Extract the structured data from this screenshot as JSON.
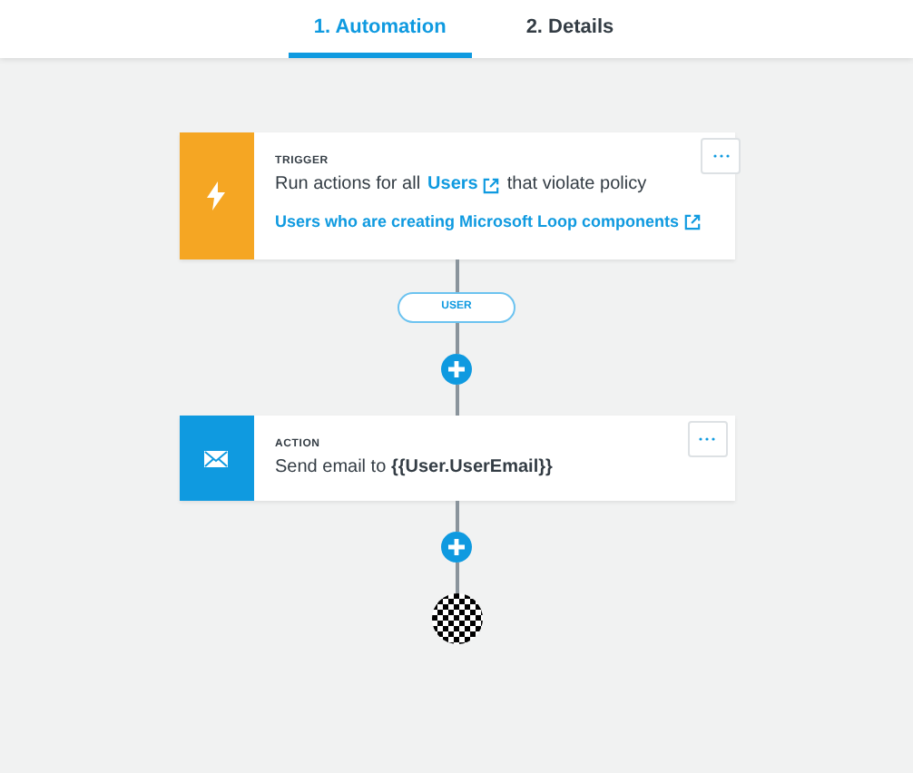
{
  "tabs": [
    {
      "label": "1. Automation",
      "selected": true
    },
    {
      "label": "2. Details",
      "selected": false
    }
  ],
  "steps": [
    {
      "kind": "trigger",
      "label": "TRIGGER",
      "parts": [
        {
          "kind": "text",
          "text": "Run actions for all"
        },
        {
          "kind": "link",
          "text": "Users"
        },
        {
          "kind": "text",
          "text": "that violate policy"
        }
      ],
      "link": "Users who are creating Microsoft Loop components"
    },
    {
      "kind": "action",
      "label": "ACTION",
      "parts": [
        {
          "kind": "text",
          "text": "Send email to **{{User.UserEmail}}**"
        }
      ]
    }
  ],
  "filter_pill": "USER"
}
